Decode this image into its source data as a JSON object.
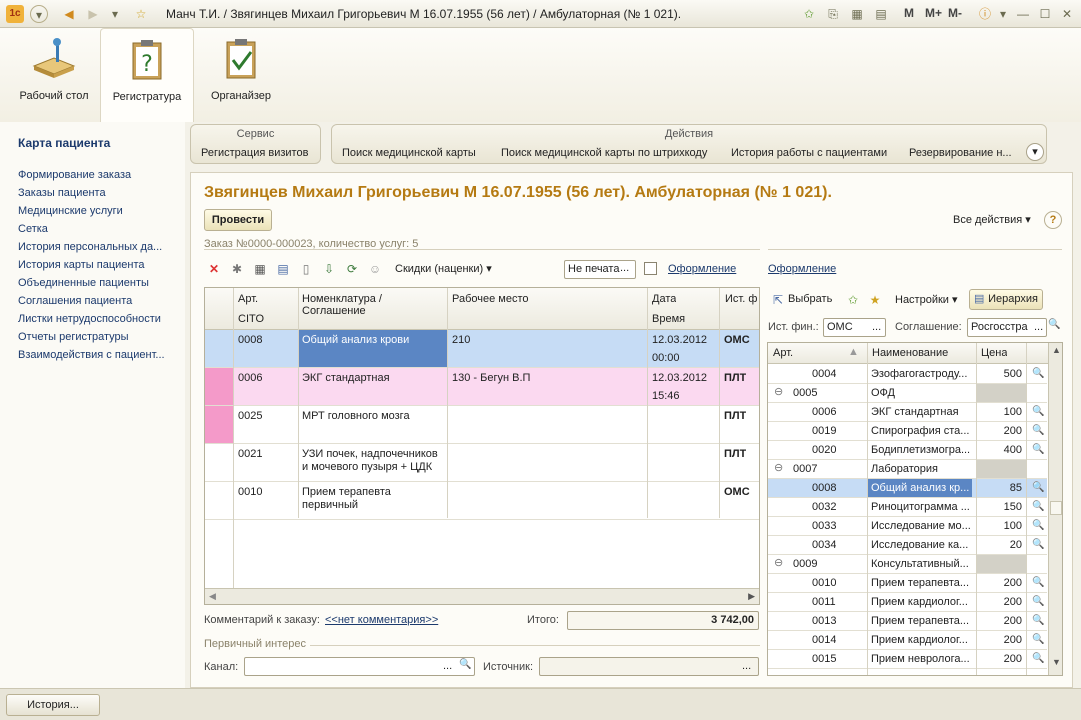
{
  "window": {
    "title": "Манч Т.И. / Звягинцев Михаил Григорьевич М 16.07.1955 (56 лет) / Амбулаторная (№ 1 021).",
    "mem_buttons": [
      "M",
      "M+",
      "M-"
    ]
  },
  "sections": [
    {
      "label": "Рабочий стол"
    },
    {
      "label": "Регистратура"
    },
    {
      "label": "Органайзер"
    }
  ],
  "left": {
    "header": "Карта пациента",
    "links": [
      "Формирование заказа",
      "Заказы пациента",
      "Медицинские услуги",
      "Сетка",
      "История персональных да...",
      "История карты пациента",
      "Объединенные пациенты",
      "Соглашения пациента",
      "Листки нетрудоспособности",
      "Отчеты регистратуры",
      "Взаимодействия с пациент..."
    ]
  },
  "service": {
    "title": "Сервис",
    "items": [
      "Регистрация визитов"
    ]
  },
  "actions": {
    "title": "Действия",
    "items": [
      "Поиск медицинской карты",
      "Поиск медицинской карты по штрихкоду",
      "История работы с пациентами",
      "Резервирование н..."
    ]
  },
  "form": {
    "title": "Звягинцев Михаил Григорьевич М 16.07.1955 (56 лет). Амбулаторная (№ 1 021).",
    "post_button": "Провести",
    "all_actions": "Все действия ▾",
    "help": "?",
    "order_info": "Заказ №0000-000023, количество услуг: 5",
    "discounts": "Скидки (наценки) ▾",
    "print_status": "Не печата",
    "print_more": "...",
    "design_link": "Оформление",
    "design_link2": "Оформление"
  },
  "orders": {
    "headers": {
      "art": "Арт.",
      "cito": "CITO",
      "nom": "Номенклатура /",
      "nom2": "Соглашение",
      "place": "Рабочее место",
      "date": "Дата",
      "time": "Время",
      "src": "Ист. ф"
    },
    "rows": [
      {
        "art": "0008",
        "nom": "Общий анализ крови",
        "nom2": "",
        "place": "210",
        "date": "12.03.2012",
        "time": "00:00",
        "src": "ОМС"
      },
      {
        "art": "0006",
        "nom": "ЭКГ стандартная",
        "nom2": "",
        "place": "130 - Бегун В.П",
        "date": "12.03.2012",
        "time": "15:46",
        "src": "ПЛТ"
      },
      {
        "art": "0025",
        "nom": "МРТ головного мозга",
        "nom2": "",
        "place": "",
        "date": "",
        "time": "",
        "src": "ПЛТ"
      },
      {
        "art": "0021",
        "nom": "УЗИ почек, надпочечников",
        "nom2": "и мочевого пузыря + ЦДК",
        "place": "",
        "date": "",
        "time": "",
        "src": "ПЛТ"
      },
      {
        "art": "0010",
        "nom": "Прием терапевта",
        "nom2": "первичный",
        "place": "",
        "date": "",
        "time": "",
        "src": "ОМС"
      }
    ],
    "comment_label": "Комментарий к заказу:",
    "comment_link": "<<нет комментария>>",
    "total_label": "Итого:",
    "total_value": "3 742,00",
    "primary_interest": "Первичный интерес",
    "channel_label": "Канал:",
    "source_label": "Источник:",
    "ellipsis": "...",
    "magnifier": "🔍"
  },
  "catalog": {
    "select_btn": "Выбрать",
    "settings": "Настройки ▾",
    "hierarchy": "Иерархия",
    "fin_label": "Ист. фин.:",
    "fin_value": "ОМС",
    "agreement_label": "Соглашение:",
    "agreement_value": "Росгосстра",
    "headers": {
      "art": "Арт.",
      "name": "Наименование",
      "price": "Цена"
    },
    "rows": [
      {
        "art": "0004",
        "name": "Эзофагогастроду...",
        "price": "500",
        "group": false
      },
      {
        "art": "0005",
        "name": "ОФД",
        "price": "",
        "group": true
      },
      {
        "art": "0006",
        "name": "ЭКГ стандартная",
        "price": "100",
        "group": false
      },
      {
        "art": "0019",
        "name": "Спирография ста...",
        "price": "200",
        "group": false
      },
      {
        "art": "0020",
        "name": "Бодиплетизмогра...",
        "price": "400",
        "group": false
      },
      {
        "art": "0007",
        "name": "Лаборатория",
        "price": "",
        "group": true
      },
      {
        "art": "0008",
        "name": "Общий анализ кр...",
        "price": "85",
        "group": false,
        "selected": true
      },
      {
        "art": "0032",
        "name": "Риноцитограмма ...",
        "price": "150",
        "group": false
      },
      {
        "art": "0033",
        "name": "Исследование мо...",
        "price": "100",
        "group": false
      },
      {
        "art": "0034",
        "name": "Исследование ка...",
        "price": "20",
        "group": false
      },
      {
        "art": "0009",
        "name": "Консультативный...",
        "price": "",
        "group": true
      },
      {
        "art": "0010",
        "name": "Прием терапевта...",
        "price": "200",
        "group": false
      },
      {
        "art": "0011",
        "name": "Прием кардиолог...",
        "price": "200",
        "group": false
      },
      {
        "art": "0013",
        "name": "Прием терапевта...",
        "price": "200",
        "group": false
      },
      {
        "art": "0014",
        "name": "Прием кардиолог...",
        "price": "200",
        "group": false
      },
      {
        "art": "0015",
        "name": "Прием невролога...",
        "price": "200",
        "group": false
      }
    ]
  },
  "bottom": {
    "history": "История..."
  },
  "colors": {
    "accent_title": "#b57a12",
    "selected_row": "#c6dcf5",
    "pink_row": "#fbd9f0",
    "selected_cell": "#5b86c4"
  }
}
